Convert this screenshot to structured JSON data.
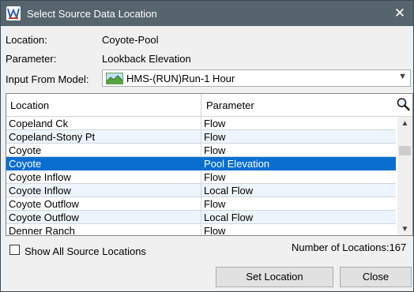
{
  "window": {
    "title": "Select Source Data Location"
  },
  "info": {
    "location_label": "Location:",
    "location_value": "Coyote-Pool",
    "parameter_label": "Parameter:",
    "parameter_value": "Lookback Elevation",
    "model_label": "Input From Model:",
    "model_value": "HMS-(RUN)Run-1 Hour"
  },
  "table": {
    "headers": [
      "Location",
      "Parameter"
    ],
    "rows": [
      {
        "location": "Copeland Ck",
        "parameter": "Flow"
      },
      {
        "location": "Copeland-Stony Pt",
        "parameter": "Flow"
      },
      {
        "location": "Coyote",
        "parameter": "Flow"
      },
      {
        "location": "Coyote",
        "parameter": "Pool Elevation"
      },
      {
        "location": "Coyote Inflow",
        "parameter": "Flow"
      },
      {
        "location": "Coyote Inflow",
        "parameter": "Local Flow"
      },
      {
        "location": "Coyote Outflow",
        "parameter": "Flow"
      },
      {
        "location": "Coyote Outflow",
        "parameter": "Local Flow"
      },
      {
        "location": "Denner Ranch",
        "parameter": "Flow"
      }
    ],
    "selected_row": 3
  },
  "footer": {
    "show_all_label": "Show All Source Locations",
    "count_text": "Number of Locations:167",
    "set_location_label": "Set Location",
    "close_label": "Close"
  },
  "icons": {
    "app": "app-logo-icon",
    "close": "close-icon",
    "model": "hms-model-icon",
    "dropdown": "chevron-down-icon",
    "search": "search-icon"
  },
  "colors": {
    "titlebar": "#56646e",
    "selection": "#0a6ed1",
    "alt_row": "#eef4fb"
  }
}
